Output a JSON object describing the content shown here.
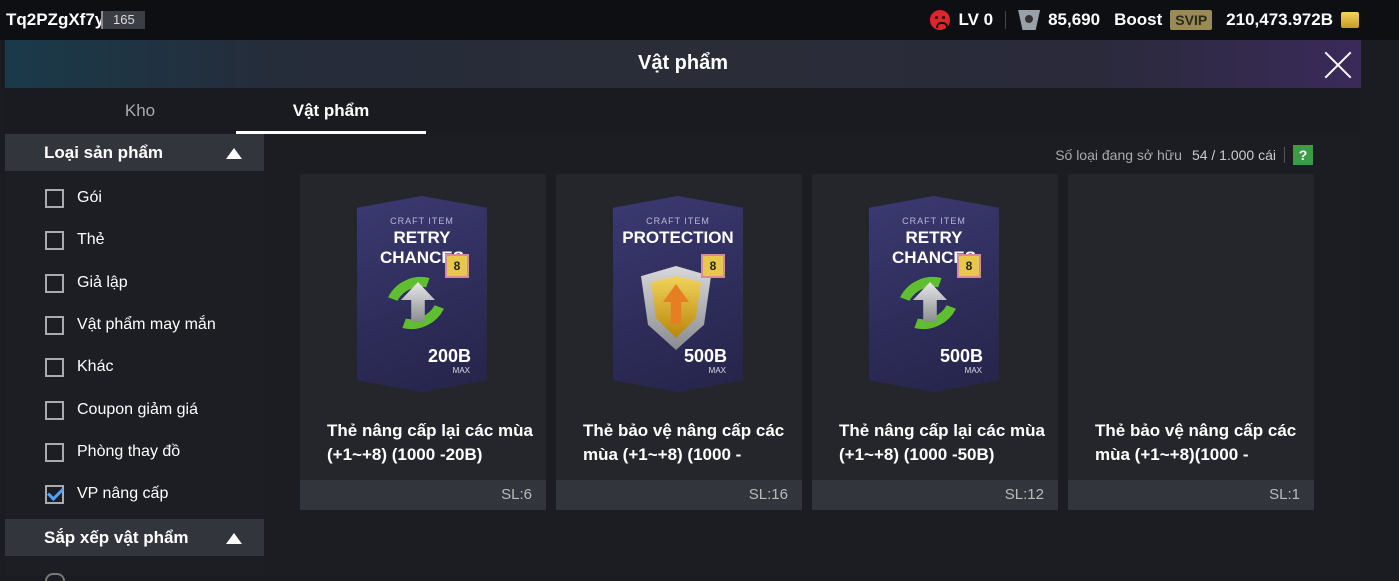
{
  "topbar": {
    "username": "Tq2PZgXf7y",
    "level": "165",
    "lv": "LV 0",
    "points": "85,690",
    "boost": "Boost",
    "svip": "SVIP",
    "balance": "210,473.972B"
  },
  "panel": {
    "title": "Vật phẩm",
    "tabs": [
      {
        "label": "Kho"
      },
      {
        "label": "Vật phẩm"
      }
    ]
  },
  "sidebar": {
    "product_type_label": "Loại sản phẩm",
    "filters": [
      {
        "label": "Gói",
        "checked": false
      },
      {
        "label": "Thẻ",
        "checked": false
      },
      {
        "label": "Giả lập",
        "checked": false
      },
      {
        "label": "Vật phẩm may mắn",
        "checked": false
      },
      {
        "label": "Khác",
        "checked": false
      },
      {
        "label": "Coupon giảm giá",
        "checked": false
      },
      {
        "label": "Phòng thay đồ",
        "checked": false
      },
      {
        "label": "VP nâng cấp",
        "checked": true
      }
    ],
    "sort_label": "Sắp xếp vật phẩm"
  },
  "content": {
    "owned_label": "Số loại đang sở hữu",
    "owned_value": "54 / 1.000 cái",
    "help": "?",
    "items": [
      {
        "art_sub": "CRAFT ITEM",
        "art_title": "RETRY CHANCES",
        "art_badge": "8",
        "art_value": "200B",
        "art_max": "MAX",
        "emblem": "retry-arrows-icon",
        "name_line1": "Thẻ nâng cấp lại các mùa",
        "name_line2": "(+1~+8) (1000 -20B)",
        "qty": "SL:6"
      },
      {
        "art_sub": "CRAFT ITEM",
        "art_title": "PROTECTION",
        "art_badge": "8",
        "art_value": "500B",
        "art_max": "MAX",
        "emblem": "shield-icon",
        "name_line1": "Thẻ bảo vệ nâng cấp các",
        "name_line2": "mùa (+1~+8) (1000 -",
        "qty": "SL:16"
      },
      {
        "art_sub": "CRAFT ITEM",
        "art_title": "RETRY CHANCES",
        "art_badge": "8",
        "art_value": "500B",
        "art_max": "MAX",
        "emblem": "retry-arrows-icon",
        "name_line1": "Thẻ nâng cấp lại các mùa",
        "name_line2": "(+1~+8) (1000 -50B)",
        "qty": "SL:12"
      },
      {
        "name_line1": "Thẻ bảo vệ nâng cấp các",
        "name_line2": "mùa (+1~+8)(1000 -",
        "qty": "SL:1"
      }
    ]
  }
}
